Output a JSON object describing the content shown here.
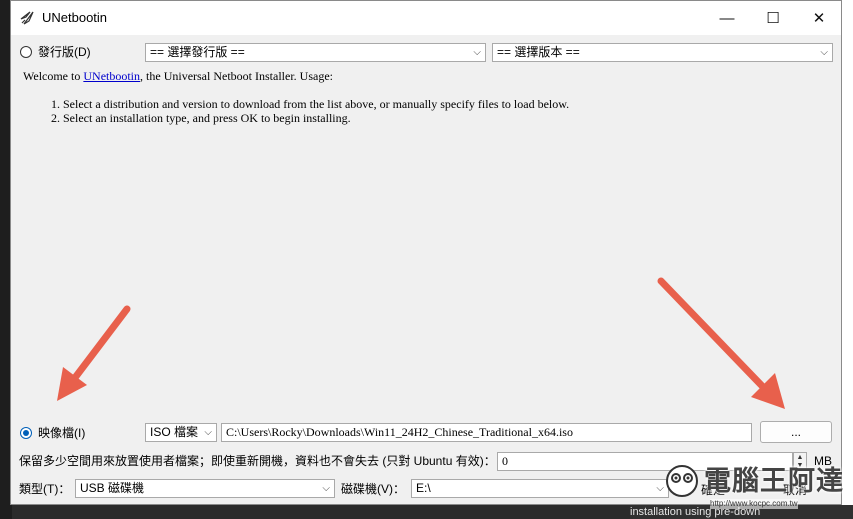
{
  "window": {
    "title": "UNetbootin"
  },
  "titlebar_buttons": {
    "minimize": "—",
    "maximize": "☐",
    "close": "✕"
  },
  "distribution": {
    "radio_label": "發行版(D)",
    "selected": false,
    "distro_select_value": "== 選擇發行版 ==",
    "version_select_value": "== 選擇版本 =="
  },
  "info": {
    "welcome_prefix": "Welcome to ",
    "welcome_link": "UNetbootin",
    "welcome_suffix": ", the Universal Netboot Installer. Usage:",
    "steps": [
      "Select a distribution and version to download from the list above, or manually specify files to load below.",
      "Select an installation type, and press OK to begin installing."
    ]
  },
  "diskimage": {
    "radio_label": "映像檔(I)",
    "selected": true,
    "type_select_value": "ISO 檔案",
    "path_value": "C:\\Users\\Rocky\\Downloads\\Win11_24H2_Chinese_Traditional_x64.iso",
    "browse_label": "..."
  },
  "persistence": {
    "label": "保留多少空間用來放置使用者檔案；即使重新開機，資料也不會失去 (只對 Ubuntu 有效)：",
    "value": "0",
    "unit": "MB"
  },
  "target": {
    "type_label": "類型(T)：",
    "type_value": "USB 磁碟機",
    "drive_label": "磁碟機(V)：",
    "drive_value": "E:\\",
    "ok_label": "確定",
    "cancel_label": "取消"
  },
  "background": {
    "bottom_text": "installation using pre-down"
  },
  "watermark": {
    "text": "電腦王阿達",
    "url": "http://www.kocpc.com.tw"
  },
  "colors": {
    "arrow": "#e8604c",
    "radio_accent": "#005fb8",
    "link": "#0000cc"
  }
}
